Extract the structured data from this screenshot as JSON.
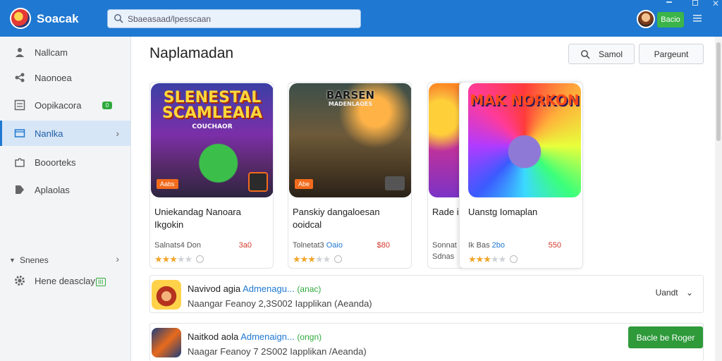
{
  "app": {
    "title": "Soacak"
  },
  "search": {
    "placeholder": "Sbaeasaad/lpesscaan"
  },
  "header": {
    "user_button": "Bacio"
  },
  "sidebar": {
    "items": [
      {
        "label": "Nallcam",
        "icon": "person-icon"
      },
      {
        "label": "Naonoea",
        "icon": "share-icon"
      },
      {
        "label": "Oopikacora",
        "icon": "list-icon",
        "badge": "0"
      },
      {
        "label": "Nanlka",
        "icon": "folder-icon",
        "active": true
      },
      {
        "label": "Booorteks",
        "icon": "puzzle-icon"
      },
      {
        "label": "Aplaolas",
        "icon": "tag-icon"
      }
    ],
    "section": {
      "label": "Snenes"
    },
    "settings": {
      "label": "Hene deasclay",
      "badge": "III"
    }
  },
  "main": {
    "title": "Naplamadan",
    "search_button": "Samol",
    "secondary_button": "Pargeunt"
  },
  "cards": [
    {
      "art_title": "SLENESTAL SCAMLEAIA",
      "art_sub": "COUCHAOR",
      "tag": "Aabs",
      "name": "Uniekandag Nanoara Ikgokin",
      "meta": "Salnats4 Don",
      "meta_hl": "",
      "price": "3a0",
      "stars": 3
    },
    {
      "art_title": "BARSEN",
      "art_sub": "MADENLAOES",
      "tag": "Abe",
      "name": "Panskiy dangaloesan ooidcal",
      "meta": "Tolnetat3",
      "meta_hl": "Oaio",
      "price": "$80",
      "stars": 3
    },
    {
      "art_title": "",
      "art_sub": "",
      "tag": "",
      "name": "Rade ixity",
      "meta": "Sonnat",
      "meta_hl": "",
      "price": "",
      "extra": "Sdnas",
      "stars": 3
    },
    {
      "art_title": "MAK NORKON",
      "art_sub": "",
      "tag": "",
      "name": "Uanstg Iomaplan",
      "meta": "Ik Bas",
      "meta_hl": "2bo",
      "price": "550",
      "stars": 3
    }
  ],
  "list": [
    {
      "title": "Navivod agia",
      "link": "Admenagu...",
      "status": "(anac)",
      "subtitle": "Naangar Feanoy 2,3S002 Iapplikan (Aeanda)",
      "action": "Uandt"
    },
    {
      "title": "Naitkod aola",
      "link": "Admenaign...",
      "status": "(ongn)",
      "subtitle": "Naagar Feanoy 7 2S002 Iapplikan /Aeanda)",
      "action": "Bacle be Roger"
    }
  ],
  "colors": {
    "accent": "#1f78d1",
    "success": "#2e9a3a",
    "price": "#d23a2a",
    "star": "#f1a52b"
  }
}
